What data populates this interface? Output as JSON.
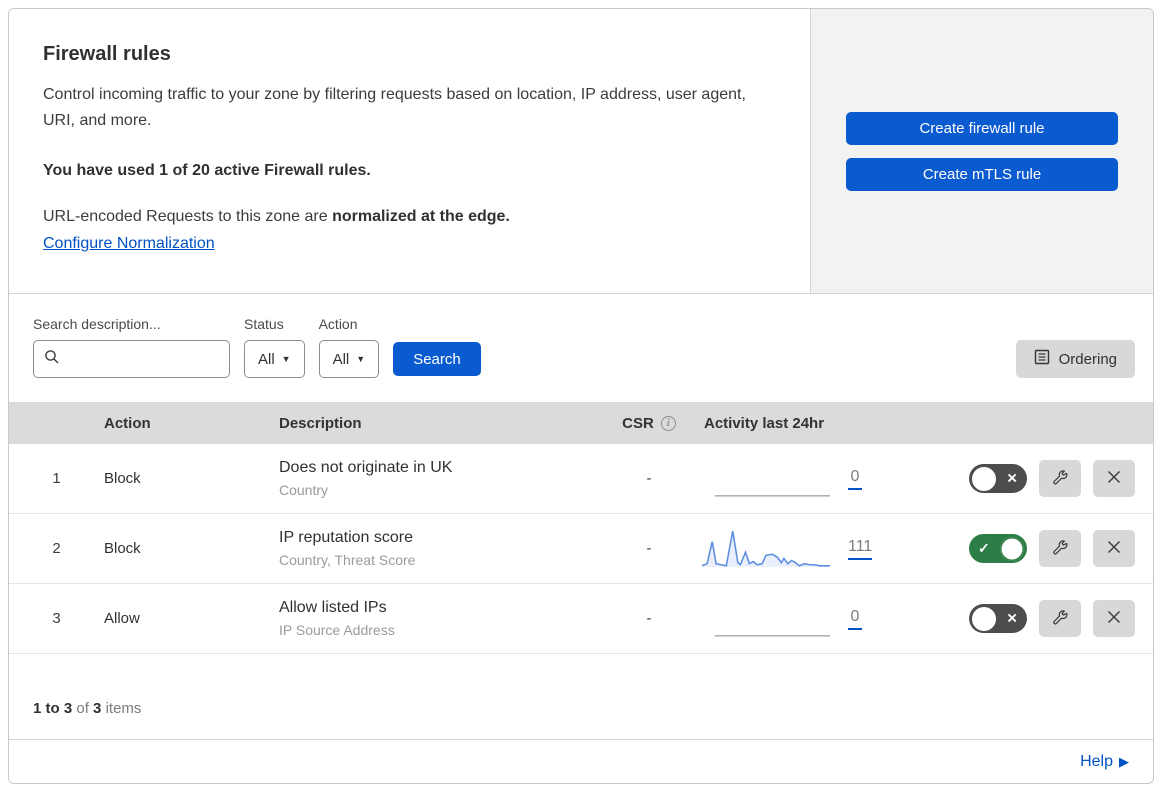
{
  "header": {
    "title": "Firewall rules",
    "description": "Control incoming traffic to your zone by filtering requests based on location, IP address, user agent, URI, and more.",
    "usage": "You have used 1 of 20 active Firewall rules.",
    "normalization_prefix": "URL-encoded Requests to this zone are ",
    "normalization_bold": "normalized at the edge.",
    "configure_link": "Configure Normalization",
    "create_firewall_button": "Create firewall rule",
    "create_mtls_button": "Create mTLS rule"
  },
  "filters": {
    "search_label": "Search description...",
    "status_label": "Status",
    "status_value": "All",
    "action_label": "Action",
    "action_value": "All",
    "search_button": "Search",
    "ordering_button": "Ordering"
  },
  "table": {
    "columns": {
      "action": "Action",
      "description": "Description",
      "csr": "CSR",
      "activity": "Activity last 24hr"
    },
    "rows": [
      {
        "index": "1",
        "action": "Block",
        "description": "Does not originate in UK",
        "fields": "Country",
        "csr": "-",
        "activity_count": "0",
        "enabled": false,
        "sparkline": "flat"
      },
      {
        "index": "2",
        "action": "Block",
        "description": "IP reputation score",
        "fields": "Country, Threat Score",
        "csr": "-",
        "activity_count": "111",
        "enabled": true,
        "sparkline": "data"
      },
      {
        "index": "3",
        "action": "Allow",
        "description": "Allow listed IPs",
        "fields": "IP Source Address",
        "csr": "-",
        "activity_count": "0",
        "enabled": false,
        "sparkline": "flat"
      }
    ],
    "footer": {
      "range": "1 to 3",
      "of": "of",
      "total": "3",
      "items": "items"
    }
  },
  "help_link": "Help",
  "colors": {
    "button_blue": "#0a5ad0",
    "link_blue": "#0051c3",
    "toggle_on_green": "#2d7d46",
    "toggle_off_gray": "#4d4d4d",
    "panel_gray": "#f2f2f2",
    "table_header_gray": "#dbdbdb",
    "sparkline_blue": "#5f8fe0"
  },
  "chart_data": {
    "type": "area",
    "title": "Rule 2 activity last 24hr sparkline",
    "total_requests": 111,
    "note": "normalized points, x 0-100 (time over 24hr), y 0-40 (40 = zero activity baseline, 0 = peak)",
    "points": [
      [
        0,
        36
      ],
      [
        4,
        34
      ],
      [
        8,
        13
      ],
      [
        11,
        34
      ],
      [
        15,
        35
      ],
      [
        19,
        36
      ],
      [
        24,
        3
      ],
      [
        28,
        33
      ],
      [
        30,
        35
      ],
      [
        34,
        23
      ],
      [
        37,
        34
      ],
      [
        40,
        32
      ],
      [
        43,
        35
      ],
      [
        47,
        34
      ],
      [
        50,
        26
      ],
      [
        55,
        25
      ],
      [
        59,
        28
      ],
      [
        62,
        33
      ],
      [
        64,
        29
      ],
      [
        67,
        34
      ],
      [
        70,
        31
      ],
      [
        73,
        33
      ],
      [
        76,
        36
      ],
      [
        80,
        34
      ],
      [
        84,
        35
      ],
      [
        88,
        35
      ],
      [
        92,
        36
      ],
      [
        96,
        36
      ],
      [
        100,
        36
      ]
    ],
    "flat_points": [
      [
        10,
        36
      ],
      [
        100,
        36
      ]
    ]
  }
}
